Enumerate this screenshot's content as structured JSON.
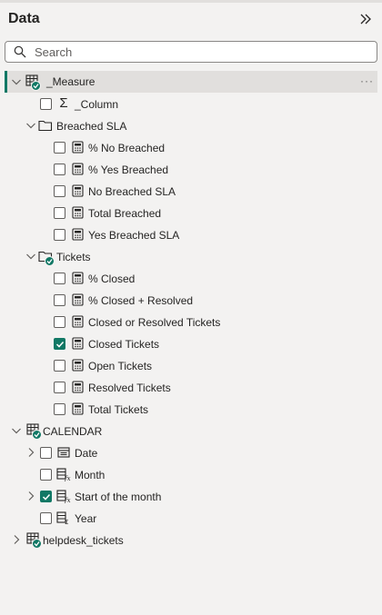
{
  "pane": {
    "title": "Data"
  },
  "search": {
    "placeholder": "Search",
    "value": ""
  },
  "tree": {
    "measure": {
      "label": "_Measure",
      "column": "_Column",
      "breached_folder": {
        "label": "Breached SLA",
        "items": [
          "% No Breached",
          "% Yes Breached",
          "No Breached SLA",
          "Total Breached",
          "Yes Breached SLA"
        ]
      },
      "tickets_folder": {
        "label": "Tickets",
        "items": [
          "% Closed",
          "% Closed + Resolved",
          "Closed or Resolved Tickets",
          "Closed Tickets",
          "Open Tickets",
          "Resolved Tickets",
          "Total Tickets"
        ]
      }
    },
    "calendar": {
      "label": "CALENDAR",
      "fields": [
        "Date",
        "Month",
        "Start of the month",
        "Year"
      ]
    },
    "helpdesk": {
      "label": "helpdesk_tickets"
    }
  },
  "colors": {
    "accent": "#117865",
    "selected_row": "#e1dfdd",
    "background": "#f3f2f1"
  }
}
